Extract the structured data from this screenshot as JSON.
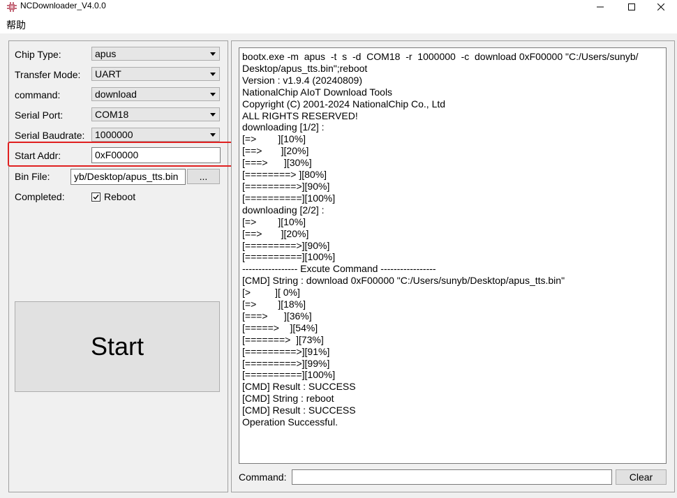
{
  "window": {
    "title": "NCDownloader_V4.0.0",
    "minimize_glyph": "—",
    "maximize_glyph": "☐",
    "close_glyph": "✕"
  },
  "menu": {
    "items": [
      {
        "label": "帮助"
      }
    ]
  },
  "settings": {
    "chip_type": {
      "label": "Chip Type:",
      "value": "apus"
    },
    "transfer_mode": {
      "label": "Transfer Mode:",
      "value": "UART"
    },
    "command": {
      "label": "command:",
      "value": "download"
    },
    "serial_port": {
      "label": "Serial Port:",
      "value": "COM18"
    },
    "serial_baudrate": {
      "label": "Serial Baudrate:",
      "value": "1000000"
    },
    "start_addr": {
      "label": "Start Addr:",
      "value": "0xF00000"
    },
    "bin_file": {
      "label": "Bin File:",
      "value": "yb/Desktop/apus_tts.bin",
      "browse_label": "..."
    },
    "completed": {
      "label": "Completed:",
      "reboot_label": "Reboot",
      "reboot_checked": true
    }
  },
  "start_button": {
    "label": "Start"
  },
  "log": {
    "lines": [
      "bootx.exe -m  apus  -t  s  -d  COM18  -r  1000000  -c  download 0xF00000 \"C:/Users/sunyb/",
      "Desktop/apus_tts.bin\";reboot",
      "Version : v1.9.4 (20240809)",
      "NationalChip AIoT Download Tools",
      "Copyright (C) 2001-2024 NationalChip Co., Ltd",
      "ALL RIGHTS RESERVED!",
      "downloading [1/2] :",
      "[=>        ][10%]",
      "[==>       ][20%]",
      "[===>      ][30%]",
      "[========> ][80%]",
      "[=========>][90%]",
      "[==========][100%]",
      "downloading [2/2] :",
      "[=>        ][10%]",
      "[==>       ][20%]",
      "[=========>][90%]",
      "[==========][100%]",
      "----------------- Excute Command -----------------",
      "[CMD] String : download 0xF00000 \"C:/Users/sunyb/Desktop/apus_tts.bin\"",
      "[>         ][ 0%]",
      "[=>        ][18%]",
      "[===>      ][36%]",
      "[=====>    ][54%]",
      "[=======>  ][73%]",
      "[=========>][91%]",
      "[=========>][99%]",
      "[==========][100%]",
      "[CMD] Result : SUCCESS",
      "[CMD] String : reboot",
      "[CMD] Result : SUCCESS",
      "Operation Successful."
    ]
  },
  "command_bar": {
    "label": "Command:",
    "value": "",
    "clear_label": "Clear"
  },
  "colors": {
    "highlight": "#e02020",
    "panel_bg": "#f0f0f0",
    "button_bg": "#e1e1e1"
  }
}
